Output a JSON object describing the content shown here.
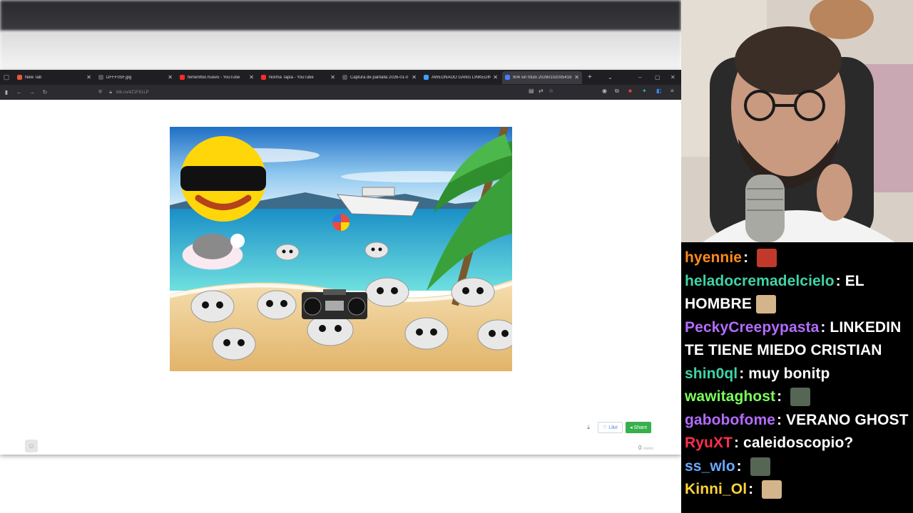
{
  "browser": {
    "tabs": [
      {
        "label": "New Tab",
        "fav_color": "#e8563d",
        "active": false
      },
      {
        "label": "DFFF0SF.jpg",
        "fav_color": "#555555",
        "active": false
      },
      {
        "label": "femenfloo huevo - YouTube",
        "fav_color": "#ff2a2a",
        "active": false
      },
      {
        "label": "Norma Tapia - YouTube",
        "fav_color": "#ff2a2a",
        "active": false
      },
      {
        "label": "Captura de pantalla 2026-01-0",
        "fav_color": "#555555",
        "active": false
      },
      {
        "label": "AWEONAOO GANG LINKEDIN",
        "fav_color": "#3ea0ff",
        "active": false
      },
      {
        "label": "904 sin título 20260102005416",
        "fav_color": "#4d7cff",
        "active": true
      }
    ],
    "url": "ibb.co/4Z1F81LP",
    "new_tab_symbol": "+"
  },
  "page": {
    "like_label": "Like",
    "share_label": "Share",
    "views_count": "0",
    "views_label": "views"
  },
  "chat": {
    "messages": [
      {
        "user": "hyennie",
        "color": "#ff8a1c",
        "text": "",
        "emote": true,
        "emote_color": "#c0392b"
      },
      {
        "user": "heladocremadelcielo",
        "color": "#3fd3a8",
        "text": "EL HOMBRE",
        "emote": true,
        "emote_color": "#d4b48a"
      },
      {
        "user": "PeckyCreepypasta",
        "color": "#b36cff",
        "text": "LINKEDIN TE TIENE MIEDO CRISTIAN",
        "emote": false
      },
      {
        "user": "shin0ql",
        "color": "#3fd3a8",
        "text": "muy bonitp",
        "emote": false
      },
      {
        "user": "wawitaghost",
        "color": "#7cff5a",
        "text": "",
        "emote": true,
        "emote_color": "#556655"
      },
      {
        "user": "gabobofome",
        "color": "#b36cff",
        "text": "VERANO GHOST",
        "emote": false
      },
      {
        "user": "RyuXT",
        "color": "#ff2e4d",
        "text": "caleidoscopio?",
        "emote": false
      },
      {
        "user": "ss_wlo",
        "color": "#6aa9ff",
        "text": "",
        "emote": true,
        "emote_color": "#556655"
      },
      {
        "user": "Kinni_Ol",
        "color": "#ffd23a",
        "text": "",
        "emote": true,
        "emote_color": "#d4b48a"
      }
    ]
  }
}
